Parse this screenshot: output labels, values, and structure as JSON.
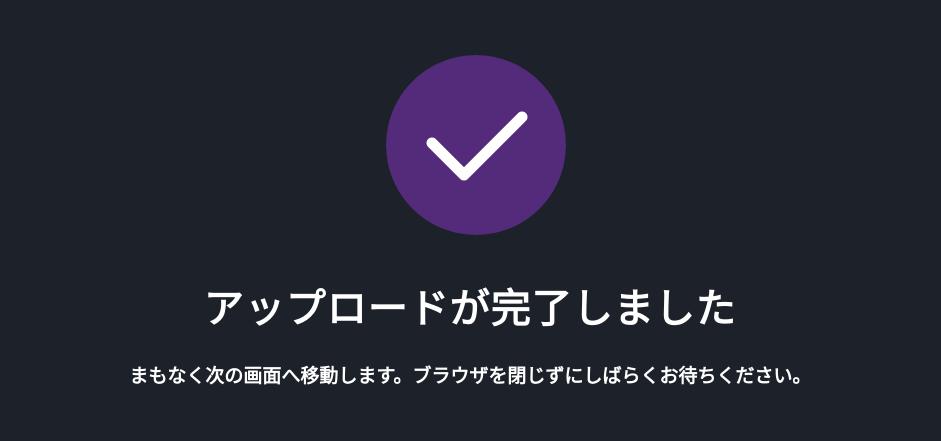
{
  "status": {
    "icon": "check-icon",
    "icon_color": "#ffffff",
    "circle_color": "#532b7a",
    "title": "アップロードが完了しました",
    "message": "まもなく次の画面へ移動します。ブラウザを閉じずにしばらくお待ちください。"
  },
  "colors": {
    "background": "#1d222a",
    "text": "#ffffff"
  }
}
